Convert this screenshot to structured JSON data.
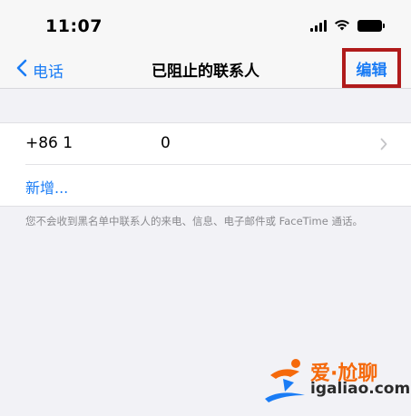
{
  "status_bar": {
    "time": "11:07",
    "icons": [
      "cellular-signal-icon",
      "wifi-icon",
      "battery-icon"
    ]
  },
  "nav": {
    "back_label": "电话",
    "title": "已阻止的联系人",
    "edit_label": "编辑",
    "accent_color": "#1a7cf5",
    "highlight_color": "#b01b1b"
  },
  "blocked_list": {
    "items": [
      {
        "number_prefix": "+86 1",
        "number_suffix": "0"
      }
    ],
    "add_label": "新增..."
  },
  "footer_note": "您不会收到黑名单中联系人的来电、信息、电子邮件或 FaceTime 通话。",
  "watermark": {
    "brand": "爱·尬聊",
    "domain": "igaliao.com"
  }
}
